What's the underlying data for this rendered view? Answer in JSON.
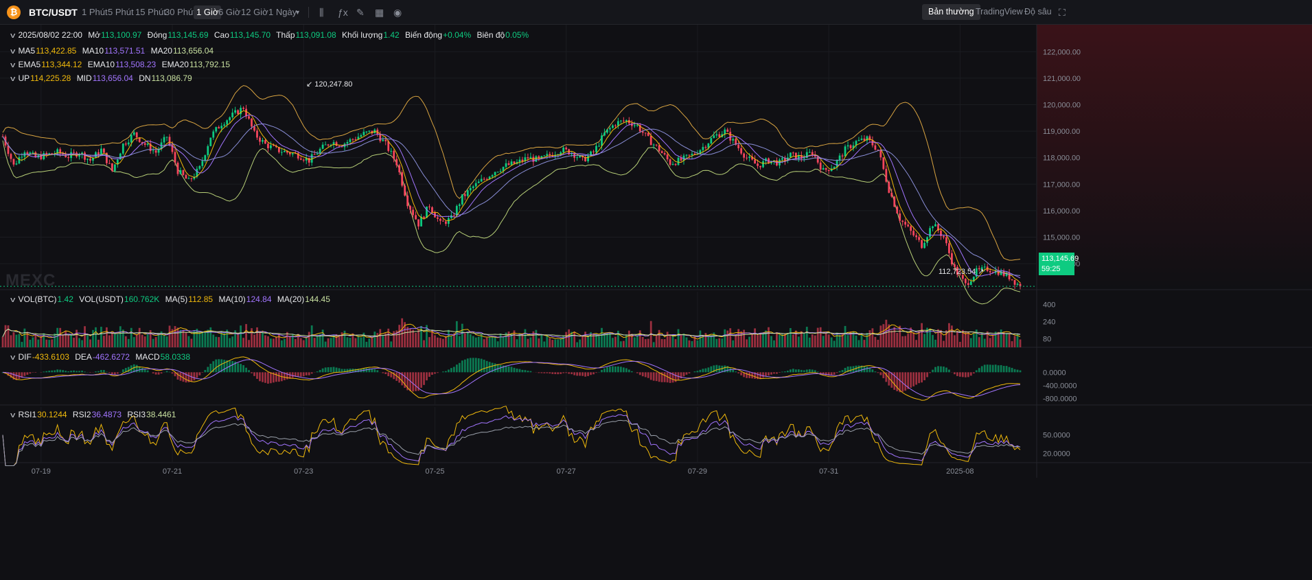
{
  "toolbar": {
    "pair": "BTC/USDT",
    "timeframes": [
      "1 Phút",
      "5 Phút",
      "15 Phút",
      "30 Phút",
      "1 Giờ",
      "6 Giờ",
      "12 Giờ",
      "1 Ngày"
    ],
    "active_timeframe": "1 Giờ",
    "views": [
      "Bản thường",
      "TradingView",
      "Độ sâu"
    ],
    "active_view": "Bản thường",
    "icons": [
      "bitcoin-icon",
      "chevron-down-icon",
      "candle-type-icon",
      "indicator-icon",
      "draw-icon",
      "layout-icon",
      "camera-icon",
      "fullscreen-icon"
    ]
  },
  "ohlc": {
    "date": "2025/08/02 22:00",
    "open_label": "Mở",
    "open": "113,100.97",
    "close_label": "Đóng",
    "close": "113,145.69",
    "high_label": "Cao",
    "high": "113,145.70",
    "low_label": "Thấp",
    "low": "113,091.08",
    "vol_label": "Khối lượng",
    "vol": "1.42",
    "change_label": "Biến động",
    "change": "+0.04%",
    "amp_label": "Biên độ",
    "amp": "0.05%"
  },
  "ma_legend": {
    "ma5_label": "MA5",
    "ma5": "113,422.85",
    "ma10_label": "MA10",
    "ma10": "113,571.51",
    "ma20_label": "MA20",
    "ma20": "113,656.04"
  },
  "ema_legend": {
    "ema5_label": "EMA5",
    "ema5": "113,344.12",
    "ema10_label": "EMA10",
    "ema10": "113,508.23",
    "ema20_label": "EMA20",
    "ema20": "113,792.15"
  },
  "boll_legend": {
    "up_label": "UP",
    "up": "114,225.28",
    "mid_label": "MID",
    "mid": "113,656.04",
    "dn_label": "DN",
    "dn": "113,086.79"
  },
  "vol_legend": {
    "vol_btc_label": "VOL(BTC)",
    "vol_btc": "1.42",
    "vol_usdt_label": "VOL(USDT)",
    "vol_usdt": "160.762K",
    "ma5_label": "MA(5)",
    "ma5": "112.85",
    "ma10_label": "MA(10)",
    "ma10": "124.84",
    "ma20_label": "MA(20)",
    "ma20": "144.45"
  },
  "macd_legend": {
    "dif_label": "DIF",
    "dif": "-433.6103",
    "dea_label": "DEA",
    "dea": "-462.6272",
    "macd_label": "MACD",
    "macd": "58.0338"
  },
  "rsi_legend": {
    "rsi1_label": "RSI1",
    "rsi1": "30.1244",
    "rsi2_label": "RSI2",
    "rsi2": "36.4873",
    "rsi3_label": "RSI3",
    "rsi3": "38.4461"
  },
  "watermark": "MEXC",
  "last_price": {
    "price": "113,145.69",
    "countdown": "59:25"
  },
  "colors": {
    "up": "#0ecb81",
    "down": "#f6465d",
    "ma5": "#f0b90b",
    "ma10": "#a275ff",
    "ma20": "#c8e0a0",
    "upband": "#d9a441",
    "dnband": "#b8d078"
  },
  "chart_data": {
    "type": "candlestick",
    "symbol": "BTC/USDT",
    "interval": "1h",
    "x_ticks": [
      "07-19",
      "07-21",
      "07-23",
      "07-25",
      "07-27",
      "07-29",
      "07-31",
      "2025-08"
    ],
    "price_axis": {
      "ticks": [
        "122,000.00",
        "121,000.00",
        "120,000.00",
        "119,000.00",
        "118,000.00",
        "117,000.00",
        "116,000.00",
        "115,000.00",
        "114,000.00"
      ],
      "ylim": [
        112500,
        122500
      ]
    },
    "price_path": [
      [
        0,
        118800
      ],
      [
        4,
        117700
      ],
      [
        8,
        118300
      ],
      [
        12,
        118000
      ],
      [
        16,
        118100
      ],
      [
        20,
        118200
      ],
      [
        24,
        118050
      ],
      [
        28,
        118200
      ],
      [
        32,
        117900
      ],
      [
        36,
        118300
      ],
      [
        40,
        117500
      ],
      [
        44,
        118500
      ],
      [
        48,
        118900
      ],
      [
        52,
        118500
      ],
      [
        56,
        118200
      ],
      [
        60,
        118800
      ],
      [
        64,
        117500
      ],
      [
        68,
        117100
      ],
      [
        72,
        117600
      ],
      [
        76,
        118800
      ],
      [
        80,
        119300
      ],
      [
        84,
        119600
      ],
      [
        88,
        119900
      ],
      [
        92,
        118900
      ],
      [
        96,
        118500
      ],
      [
        100,
        118300
      ],
      [
        104,
        118200
      ],
      [
        108,
        118100
      ],
      [
        112,
        117900
      ],
      [
        116,
        118300
      ],
      [
        120,
        118600
      ],
      [
        124,
        118500
      ],
      [
        128,
        118700
      ],
      [
        132,
        118900
      ],
      [
        136,
        119000
      ],
      [
        140,
        118500
      ],
      [
        144,
        117800
      ],
      [
        148,
        116300
      ],
      [
        152,
        115500
      ],
      [
        156,
        116200
      ],
      [
        160,
        115500
      ],
      [
        164,
        115700
      ],
      [
        168,
        116500
      ],
      [
        172,
        116900
      ],
      [
        176,
        117200
      ],
      [
        180,
        117500
      ],
      [
        184,
        117700
      ],
      [
        188,
        117800
      ],
      [
        192,
        118000
      ],
      [
        196,
        117900
      ],
      [
        200,
        118100
      ],
      [
        204,
        118300
      ],
      [
        208,
        118200
      ],
      [
        212,
        117900
      ],
      [
        216,
        118200
      ],
      [
        220,
        118900
      ],
      [
        224,
        119300
      ],
      [
        228,
        119400
      ],
      [
        232,
        119200
      ],
      [
        236,
        118700
      ],
      [
        240,
        118300
      ],
      [
        244,
        117800
      ],
      [
        248,
        117900
      ],
      [
        252,
        118100
      ],
      [
        256,
        118400
      ],
      [
        260,
        118800
      ],
      [
        264,
        119000
      ],
      [
        268,
        118500
      ],
      [
        272,
        118000
      ],
      [
        276,
        117700
      ],
      [
        280,
        117900
      ],
      [
        284,
        117800
      ],
      [
        288,
        118100
      ],
      [
        292,
        118000
      ],
      [
        296,
        118200
      ],
      [
        300,
        117500
      ],
      [
        304,
        117700
      ],
      [
        308,
        118300
      ],
      [
        312,
        118600
      ],
      [
        316,
        118700
      ],
      [
        320,
        118300
      ],
      [
        324,
        116800
      ],
      [
        328,
        115700
      ],
      [
        332,
        115200
      ],
      [
        336,
        114700
      ],
      [
        340,
        115500
      ],
      [
        344,
        115000
      ],
      [
        348,
        113800
      ],
      [
        352,
        113200
      ],
      [
        356,
        113700
      ],
      [
        360,
        113800
      ],
      [
        364,
        113700
      ],
      [
        368,
        113500
      ],
      [
        372,
        113145
      ]
    ],
    "annotations": [
      {
        "label": "120,247.80",
        "kind": "high"
      },
      {
        "label": "112,723.54",
        "kind": "low"
      }
    ],
    "volume_axis": {
      "ticks": [
        "400",
        "240",
        "80"
      ]
    },
    "macd_axis": {
      "ticks": [
        "0.0000",
        "-400.0000",
        "-800.0000"
      ]
    },
    "rsi_axis": {
      "ticks": [
        "50.0000",
        "20.0000"
      ]
    }
  }
}
